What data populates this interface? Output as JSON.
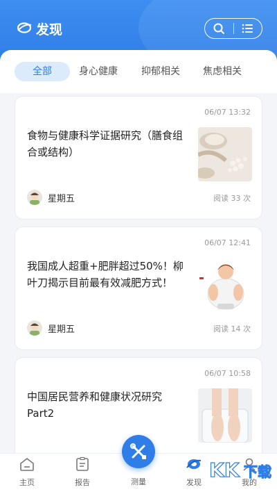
{
  "header": {
    "title": "发现"
  },
  "tabs": [
    {
      "label": "全部",
      "active": true
    },
    {
      "label": "身心健康",
      "active": false
    },
    {
      "label": "抑郁相关",
      "active": false
    },
    {
      "label": "焦虑相关",
      "active": false
    }
  ],
  "articles": [
    {
      "time": "06/07 13:32",
      "title": "食物与健康科学证据研究（膳食组合或结构）",
      "author": "星期五",
      "reads": "阅读 33 次"
    },
    {
      "time": "06/07 12:41",
      "title": "我国成人超重+肥胖超过50%！柳叶刀揭示目前最有效减肥方式！",
      "author": "星期五",
      "reads": "阅读 14 次"
    },
    {
      "time": "06/07 10:58",
      "title": "中国居民营养和健康状况研究Part2",
      "author": "",
      "reads": ""
    }
  ],
  "tabbar": {
    "home": "主页",
    "report": "报告",
    "measure": "测量",
    "discover": "发现",
    "mine": "我的"
  },
  "watermark": "KK下载",
  "colors": {
    "primary": "#2f7ee8",
    "tab_active_bg": "#dcebfc"
  }
}
